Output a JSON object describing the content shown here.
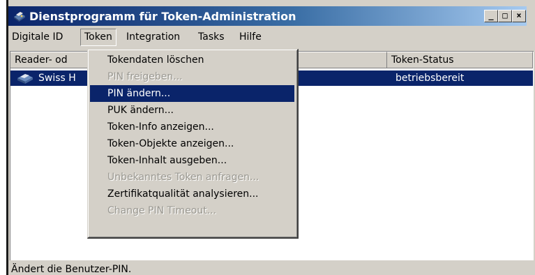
{
  "window": {
    "title": "Dienstprogramm für Token-Administration"
  },
  "title_buttons": {
    "minimize": "_",
    "maximize": "□",
    "close": "×"
  },
  "menubar": [
    "Digitale ID",
    "Token",
    "Integration",
    "Tasks",
    "Hilfe"
  ],
  "columns": [
    "Reader- od",
    "Token-Status"
  ],
  "selected_row": {
    "name": "Swiss H",
    "status": "betriebsbereit",
    "icon": "smartcard-reader-icon"
  },
  "token_menu": [
    {
      "label": "Tokendaten löschen",
      "state": "enabled"
    },
    {
      "label": "PIN freigeben...",
      "state": "disabled"
    },
    {
      "label": "PIN ändern...",
      "state": "highlighted"
    },
    {
      "label": "PUK ändern...",
      "state": "enabled"
    },
    {
      "label": "Token-Info anzeigen...",
      "state": "enabled"
    },
    {
      "label": "Token-Objekte anzeigen...",
      "state": "enabled"
    },
    {
      "label": "Token-Inhalt ausgeben...",
      "state": "enabled"
    },
    {
      "label": "Unbekanntes Token anfragen...",
      "state": "disabled"
    },
    {
      "label": "Zertifikatqualität analysieren...",
      "state": "enabled"
    },
    {
      "label": "Change PIN Timeout...",
      "state": "disabled"
    }
  ],
  "statusbar": "Ändert die Benutzer-PIN.",
  "colors": {
    "title_start": "#0a246a",
    "title_end": "#a6caf0",
    "selection": "#0a246a",
    "face": "#d4d0c8"
  }
}
